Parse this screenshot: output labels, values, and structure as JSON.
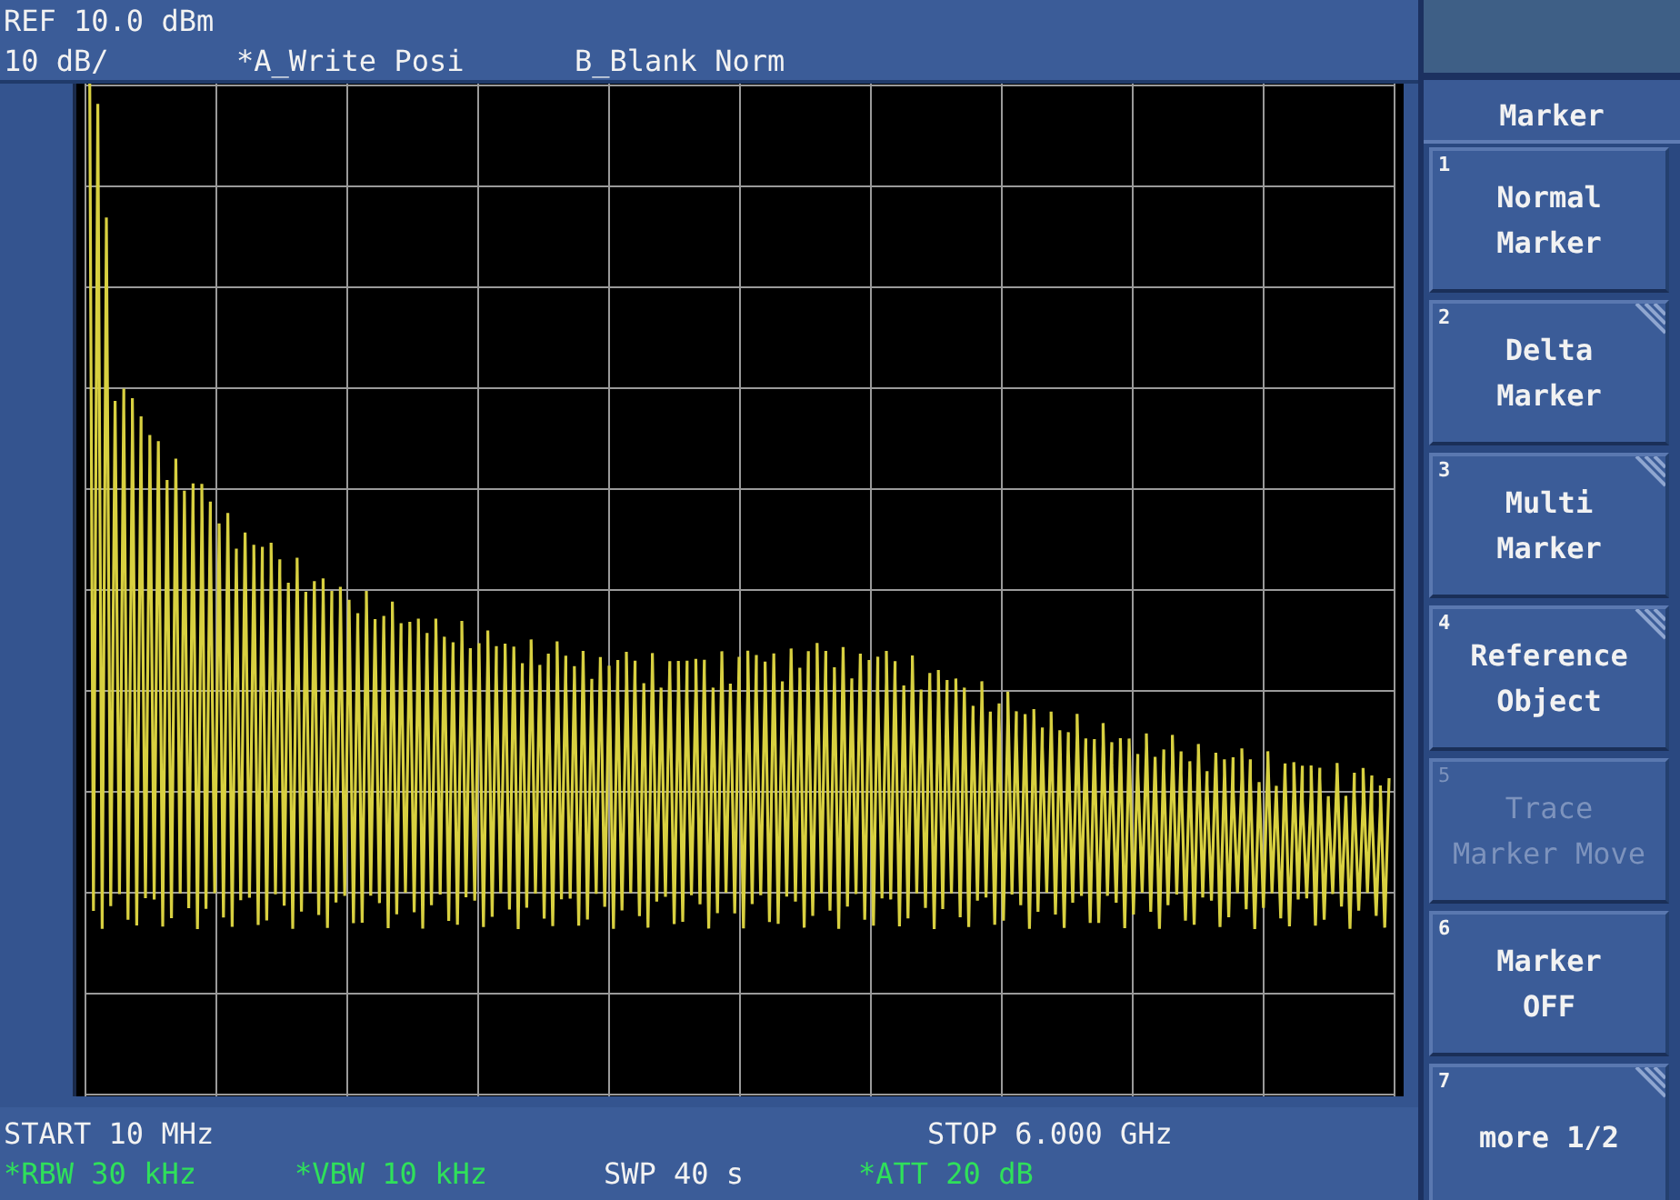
{
  "header": {
    "ref_level": "REF 10.0 dBm",
    "scale": "10 dB/",
    "trace_a": "*A_Write Posi",
    "trace_b": "B_Blank Norm"
  },
  "softkey_menu": {
    "title": "Marker",
    "keys": [
      {
        "number": "1",
        "lines": [
          "Normal",
          "Marker"
        ],
        "disabled": false,
        "submenu": false
      },
      {
        "number": "2",
        "lines": [
          "Delta",
          "Marker"
        ],
        "disabled": false,
        "submenu": true
      },
      {
        "number": "3",
        "lines": [
          "Multi",
          "Marker"
        ],
        "disabled": false,
        "submenu": true
      },
      {
        "number": "4",
        "lines": [
          "Reference",
          "Object"
        ],
        "disabled": false,
        "submenu": true
      },
      {
        "number": "5",
        "lines": [
          "Trace",
          "Marker Move"
        ],
        "disabled": true,
        "submenu": false
      },
      {
        "number": "6",
        "lines": [
          "Marker",
          "OFF"
        ],
        "disabled": false,
        "submenu": false
      },
      {
        "number": "7",
        "lines": [
          "more 1/2"
        ],
        "disabled": false,
        "submenu": true
      }
    ]
  },
  "footer": {
    "start": "START 10 MHz",
    "stop": "STOP 6.000 GHz",
    "settings": [
      {
        "text": "*RBW 30 kHz",
        "manual": true
      },
      {
        "text": "*VBW 10 kHz",
        "manual": true
      },
      {
        "text": "SWP 40 s",
        "manual": false
      },
      {
        "text": "*ATT 20 dB",
        "manual": true
      }
    ]
  }
}
